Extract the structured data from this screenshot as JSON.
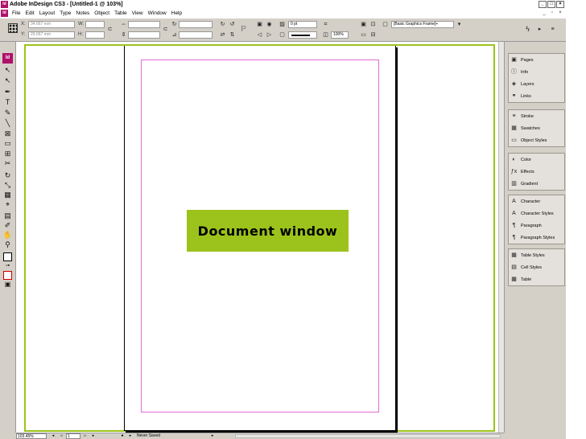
{
  "window": {
    "title": "Adobe InDesign CS3 - [Untitled-1 @ 103%]",
    "app_icon": "Id",
    "buttons": {
      "minimize": "_",
      "maximize": "□",
      "close": "×"
    }
  },
  "menu": {
    "items": [
      "File",
      "Edit",
      "Layout",
      "Type",
      "Notes",
      "Object",
      "Table",
      "View",
      "Window",
      "Help"
    ],
    "doc_controls": {
      "minimize": "_",
      "restore": "▫",
      "close": "×"
    }
  },
  "control_panel": {
    "x_label": "X:",
    "y_label": "Y:",
    "w_label": "W:",
    "h_label": "H:",
    "x_value": "34.667 mm",
    "y_value": "29.667 mm",
    "stroke_weight": "0 pt",
    "opacity": "100%",
    "object_style": "[Basic Graphics Frame]+"
  },
  "tools": {
    "logo": "Id",
    "items": [
      {
        "name": "selection-tool-icon",
        "glyph": "↖"
      },
      {
        "name": "direct-selection-tool-icon",
        "glyph": "↖"
      },
      {
        "name": "pen-tool-icon",
        "glyph": "✒"
      },
      {
        "name": "type-tool-icon",
        "glyph": "T"
      },
      {
        "name": "pencil-tool-icon",
        "glyph": "✎"
      },
      {
        "name": "line-tool-icon",
        "glyph": "╲"
      },
      {
        "name": "frame-tool-icon",
        "glyph": "⊠"
      },
      {
        "name": "rectangle-tool-icon",
        "glyph": "▭"
      },
      {
        "name": "button-tool-icon",
        "glyph": "⊞"
      },
      {
        "name": "scissors-tool-icon",
        "glyph": "✂"
      },
      {
        "name": "rotate-tool-icon",
        "glyph": "↻"
      },
      {
        "name": "scale-tool-icon",
        "glyph": "⤡"
      },
      {
        "name": "gradient-tool-icon",
        "glyph": "▦"
      },
      {
        "name": "free-transform-tool-icon",
        "glyph": "⌖"
      },
      {
        "name": "note-tool-icon",
        "glyph": "▤"
      },
      {
        "name": "eyedropper-tool-icon",
        "glyph": "✐"
      },
      {
        "name": "hand-tool-icon",
        "glyph": "✋"
      },
      {
        "name": "zoom-tool-icon",
        "glyph": "⚲"
      }
    ]
  },
  "document": {
    "callout": "Document window",
    "accent": "#9cc31c",
    "margin_guide_color": "#e36bd0"
  },
  "panels": {
    "groups": [
      [
        {
          "icon": "pages-icon",
          "glyph": "▣",
          "label": "Pages"
        },
        {
          "icon": "info-icon",
          "glyph": "ⓘ",
          "label": "Info"
        },
        {
          "icon": "layers-icon",
          "glyph": "◈",
          "label": "Layers"
        },
        {
          "icon": "links-icon",
          "glyph": "⚭",
          "label": "Links"
        }
      ],
      [
        {
          "icon": "stroke-icon",
          "glyph": "≡",
          "label": "Stroke"
        },
        {
          "icon": "swatches-icon",
          "glyph": "▦",
          "label": "Swatches"
        },
        {
          "icon": "object-styles-icon",
          "glyph": "▭",
          "label": "Object Styles"
        }
      ],
      [
        {
          "icon": "color-icon",
          "glyph": "◐",
          "label": "Color"
        },
        {
          "icon": "effects-icon",
          "glyph": "ƒx",
          "label": "Effects"
        },
        {
          "icon": "gradient-icon",
          "glyph": "▥",
          "label": "Gradient"
        }
      ],
      [
        {
          "icon": "character-icon",
          "glyph": "A",
          "label": "Character"
        },
        {
          "icon": "character-styles-icon",
          "glyph": "A",
          "label": "Character Styles"
        },
        {
          "icon": "paragraph-icon",
          "glyph": "¶",
          "label": "Paragraph"
        },
        {
          "icon": "paragraph-styles-icon",
          "glyph": "¶",
          "label": "Paragraph Styles"
        }
      ],
      [
        {
          "icon": "table-styles-icon",
          "glyph": "▦",
          "label": "Table Styles"
        },
        {
          "icon": "cell-styles-icon",
          "glyph": "▤",
          "label": "Cell Styles"
        },
        {
          "icon": "table-icon",
          "glyph": "▦",
          "label": "Table"
        }
      ]
    ]
  },
  "status": {
    "zoom": "103.45%",
    "page": "1",
    "save_state": "Never Saved"
  }
}
